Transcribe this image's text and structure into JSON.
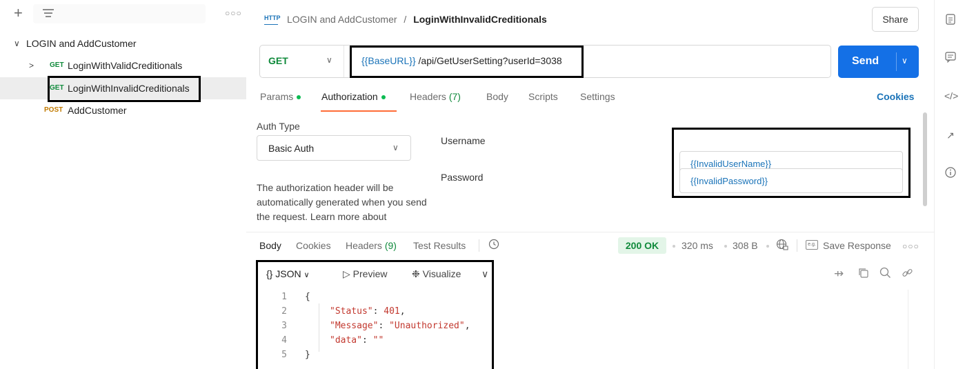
{
  "sidebar": {
    "more_glyph": "○○○",
    "collection": {
      "name": "LOGIN and AddCustomer"
    },
    "requests": [
      {
        "method": "GET",
        "name": "LoginWithValidCreditionals"
      },
      {
        "method": "GET",
        "name": "LoginWithInvalidCreditionals"
      },
      {
        "method": "POST",
        "name": "AddCustomer"
      }
    ]
  },
  "header": {
    "http_badge": "HTTP",
    "breadcrumb_collection": "LOGIN and AddCustomer",
    "breadcrumb_sep": "/",
    "breadcrumb_request": "LoginWithInvalidCreditionals",
    "share_label": "Share"
  },
  "request": {
    "method": "GET",
    "url_var": "{{BaseURL}}",
    "url_path": " /api/GetUserSetting?userId=3038",
    "send_label": "Send",
    "tabs": {
      "params": "Params",
      "authorization": "Authorization",
      "headers": "Headers",
      "headers_count": "(7)",
      "body": "Body",
      "scripts": "Scripts",
      "settings": "Settings"
    },
    "cookies_label": "Cookies"
  },
  "auth": {
    "type_label": "Auth Type",
    "type_value": "Basic Auth",
    "help_text": "The authorization header will be automatically generated when you send the request. Learn more about",
    "username_label": "Username",
    "username_value": "{{InvalidUserName}}",
    "password_label": "Password",
    "password_value": "{{InvalidPassword}}"
  },
  "response": {
    "tabs": {
      "body": "Body",
      "cookies": "Cookies",
      "headers": "Headers",
      "headers_count": "(9)",
      "test_results": "Test Results"
    },
    "status": "200 OK",
    "time": "320 ms",
    "size": "308 B",
    "save_icon_text": "e.g.",
    "save_label": "Save Response",
    "more_glyph": "○○○",
    "format": "JSON",
    "preview_label": "Preview",
    "visualize_label": "Visualize",
    "code_lines": [
      {
        "n": "1",
        "text": "{"
      },
      {
        "n": "2",
        "key": "\"Status\"",
        "colon": ": ",
        "val": "401",
        "tail": ","
      },
      {
        "n": "3",
        "key": "\"Message\"",
        "colon": ": ",
        "val": "\"Unauthorized\"",
        "tail": ","
      },
      {
        "n": "4",
        "key": "\"data\"",
        "colon": ": ",
        "val": "\"\"",
        "tail": ""
      },
      {
        "n": "5",
        "text": "}"
      }
    ]
  },
  "colors": {
    "accent_tab": "#ff6c37",
    "send_button": "#1470e6",
    "get_method": "#0f8a3b",
    "post_method": "#c17a00",
    "status_ok": "#0f8a3b"
  },
  "icons": [
    "plus-icon",
    "filter-icon",
    "more-icon",
    "chevron-down-icon",
    "chevron-right-icon",
    "http-icon",
    "docs-icon",
    "comments-icon",
    "code-icon",
    "related-icon",
    "info-icon",
    "history-icon",
    "globe-lock-icon",
    "save-icon",
    "wrap-icon",
    "copy-icon",
    "search-icon",
    "link-icon"
  ]
}
